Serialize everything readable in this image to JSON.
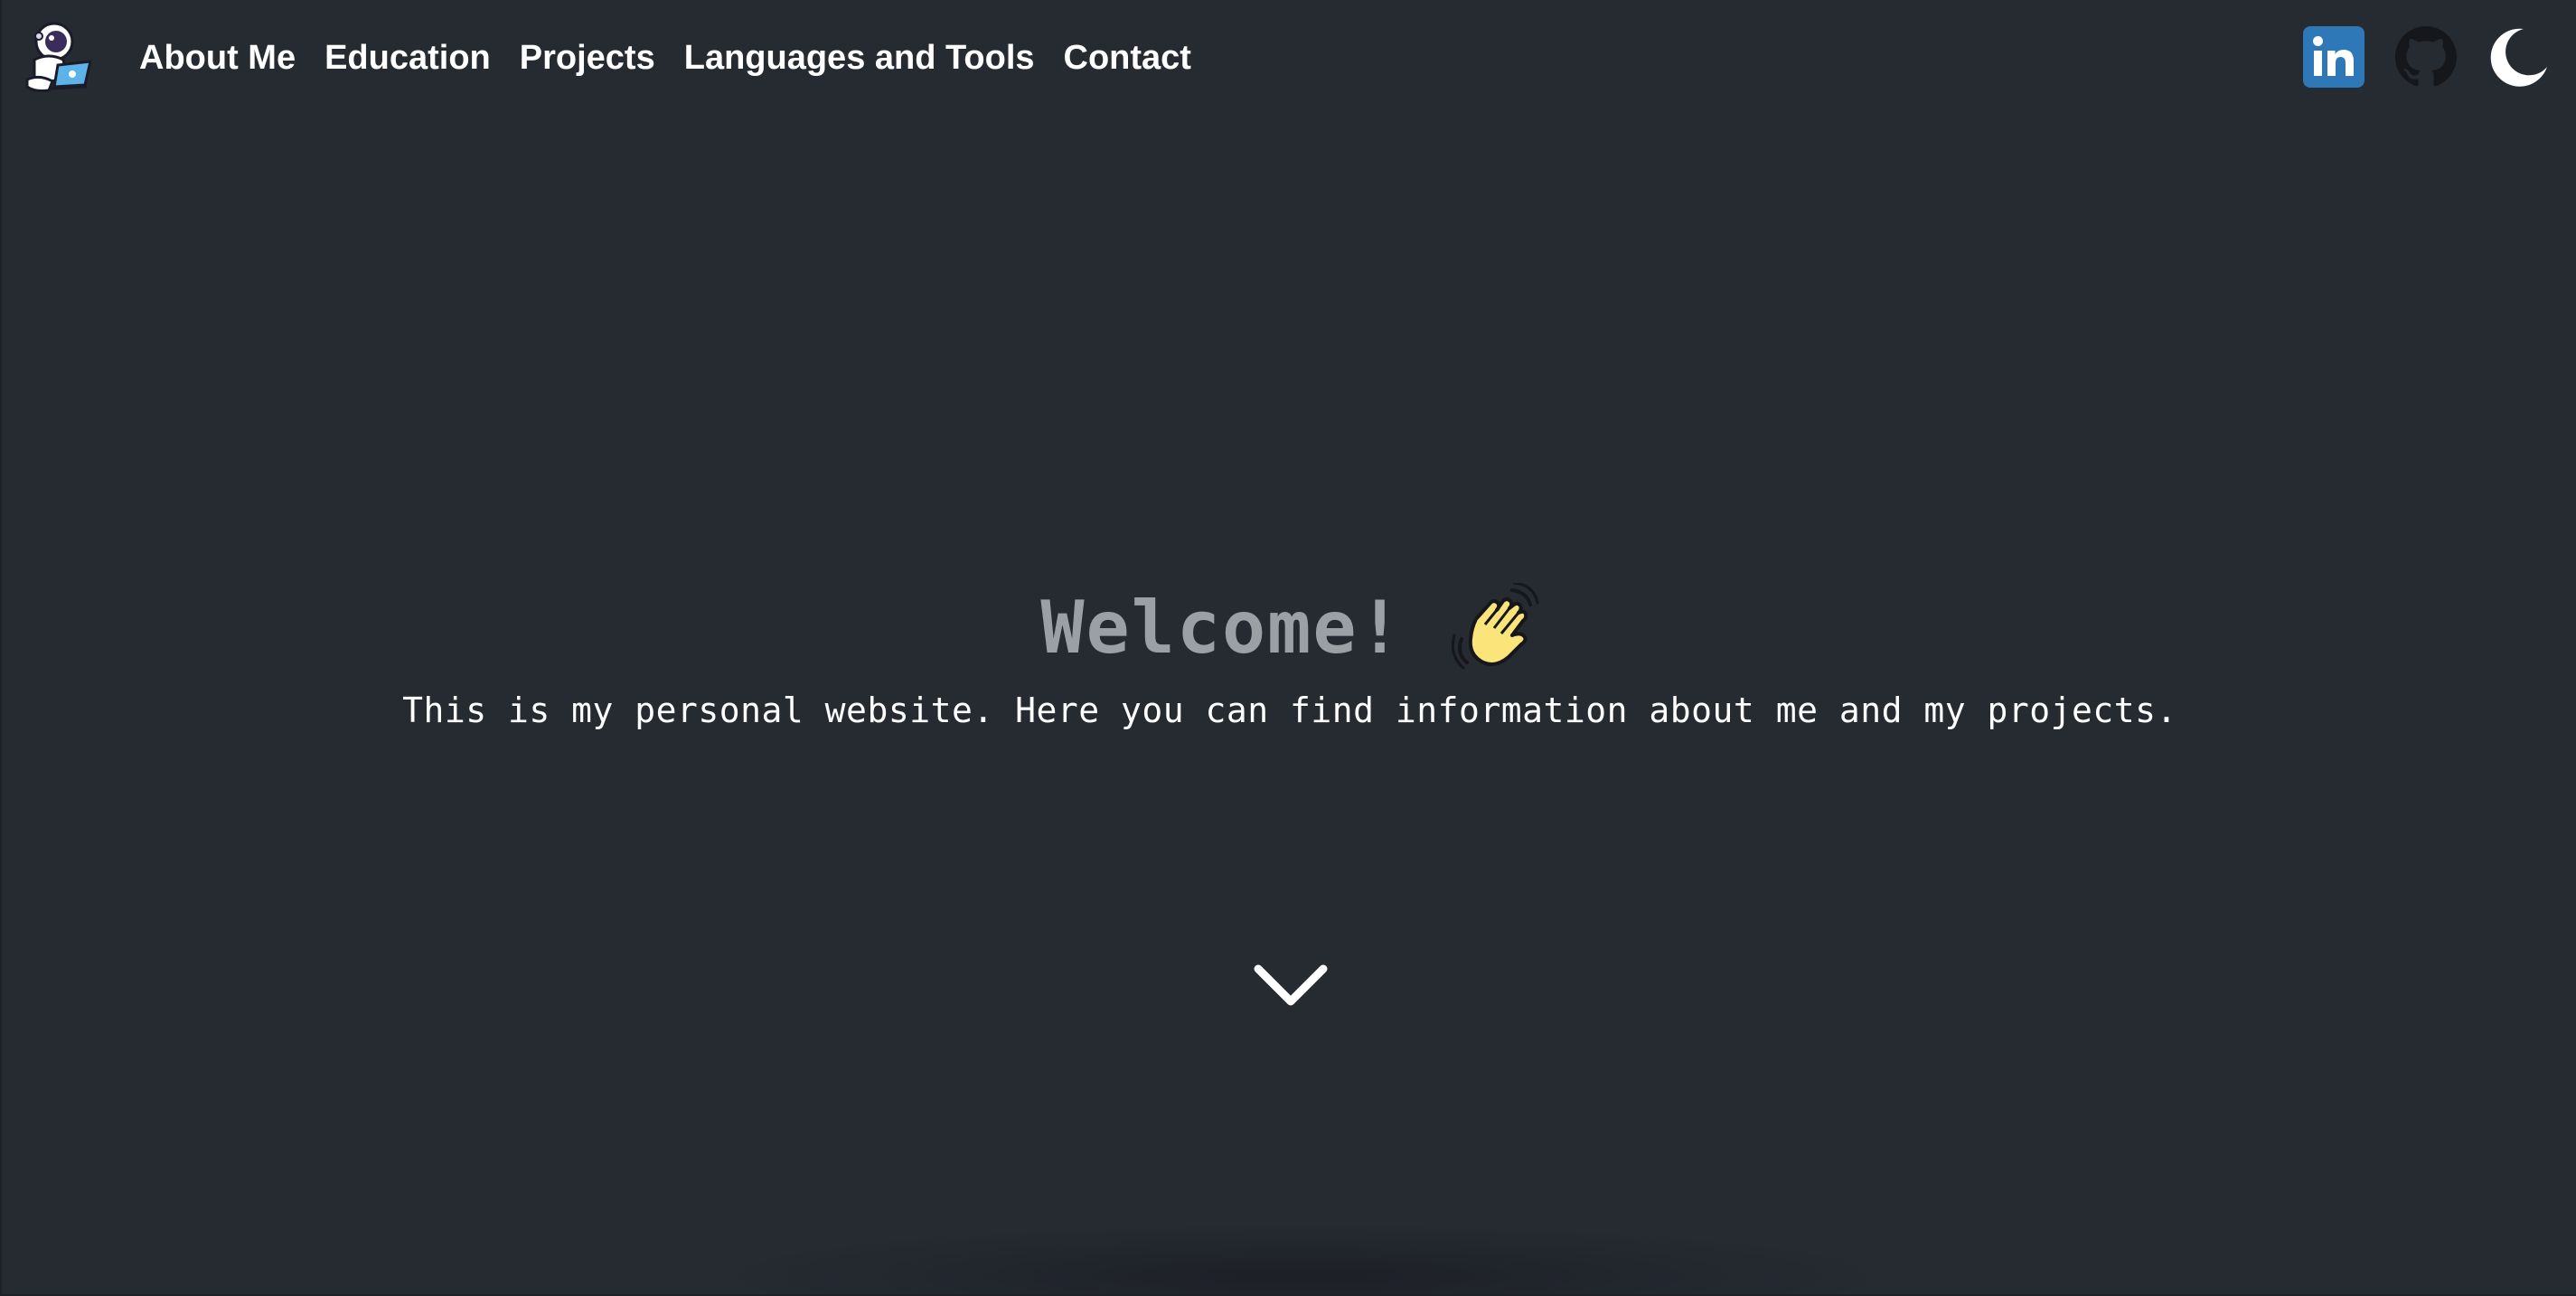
{
  "nav": {
    "links": [
      {
        "label": "About Me"
      },
      {
        "label": "Education"
      },
      {
        "label": "Projects"
      },
      {
        "label": "Languages and Tools"
      },
      {
        "label": "Contact"
      }
    ],
    "icons": {
      "logo": "astronaut-logo-icon",
      "linkedin": "linkedin-icon",
      "github": "github-icon",
      "theme": "moon-icon"
    },
    "linkedin_text": "in"
  },
  "hero": {
    "title": "Welcome!",
    "subtitle": "This is my personal website. Here you can find information about me and my projects.",
    "wave_icon": "waving-hand-icon"
  },
  "colors": {
    "background": "#262b32",
    "title": "#9aa0a3",
    "text": "#ffffff",
    "linkedin": "#2e78b7"
  }
}
